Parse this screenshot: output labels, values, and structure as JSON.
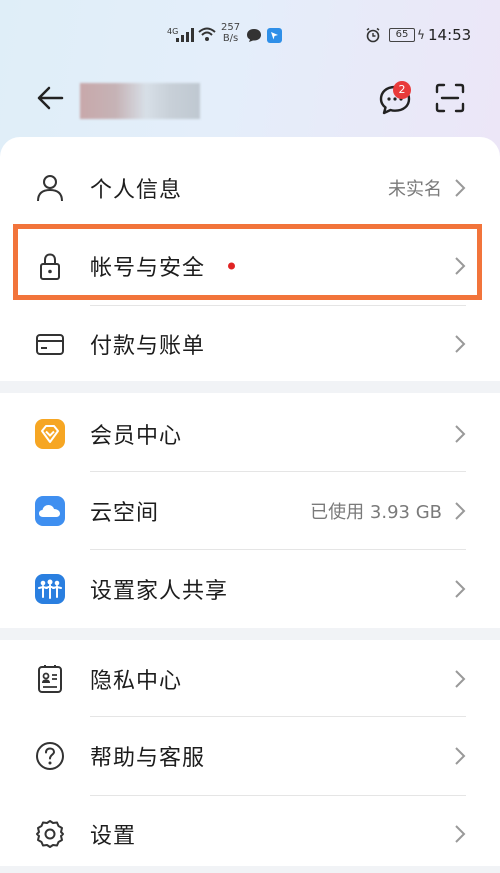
{
  "status_bar": {
    "network": "4G",
    "speed_value": "257",
    "speed_unit": "B/s",
    "battery": "65",
    "time": "14:53"
  },
  "header": {
    "notification_count": "2"
  },
  "sections": [
    {
      "items": [
        {
          "label": "个人信息",
          "right": "未实名",
          "icon": "person-icon"
        },
        {
          "label": "帐号与安全",
          "right": "",
          "icon": "lock-icon",
          "red_dot": true
        },
        {
          "label": "付款与账单",
          "right": "",
          "icon": "card-icon"
        }
      ]
    },
    {
      "items": [
        {
          "label": "会员中心",
          "right": "",
          "icon": "vip-icon"
        },
        {
          "label": "云空间",
          "right": "已使用 3.93 GB",
          "icon": "cloud-icon"
        },
        {
          "label": "设置家人共享",
          "right": "",
          "icon": "family-icon"
        }
      ]
    },
    {
      "items": [
        {
          "label": "隐私中心",
          "right": "",
          "icon": "privacy-icon"
        },
        {
          "label": "帮助与客服",
          "right": "",
          "icon": "help-icon"
        },
        {
          "label": "设置",
          "right": "",
          "icon": "settings-gear-icon"
        }
      ]
    }
  ],
  "colors": {
    "highlight": "#f2743b",
    "badge": "#e83a3a",
    "vip": "#f6a623",
    "cloud": "#3f8ff0",
    "family": "#2a7fe0"
  }
}
